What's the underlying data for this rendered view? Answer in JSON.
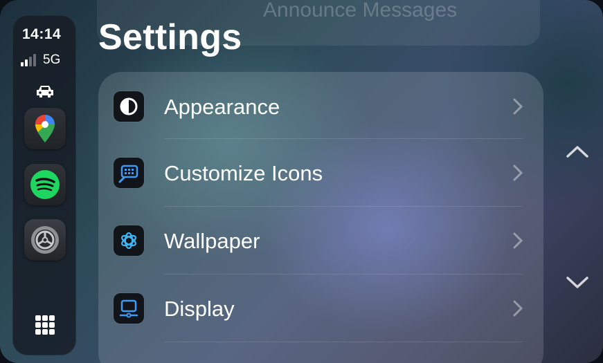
{
  "status": {
    "time": "14:14",
    "network": "5G"
  },
  "dock": {
    "icons": [
      "car-icon",
      "google-maps-icon",
      "spotify-icon",
      "settings-icon",
      "app-grid-icon"
    ]
  },
  "background_row": {
    "label": "Announce Messages"
  },
  "page": {
    "title": "Settings"
  },
  "list": [
    {
      "label": "Appearance",
      "icon": "appearance-icon"
    },
    {
      "label": "Customize Icons",
      "icon": "customize-icons-icon"
    },
    {
      "label": "Wallpaper",
      "icon": "wallpaper-icon"
    },
    {
      "label": "Display",
      "icon": "display-icon"
    }
  ],
  "colors": {
    "accent_blue": "#3f9bf5",
    "panel": "#ffffff24",
    "dock": "#161c24"
  }
}
